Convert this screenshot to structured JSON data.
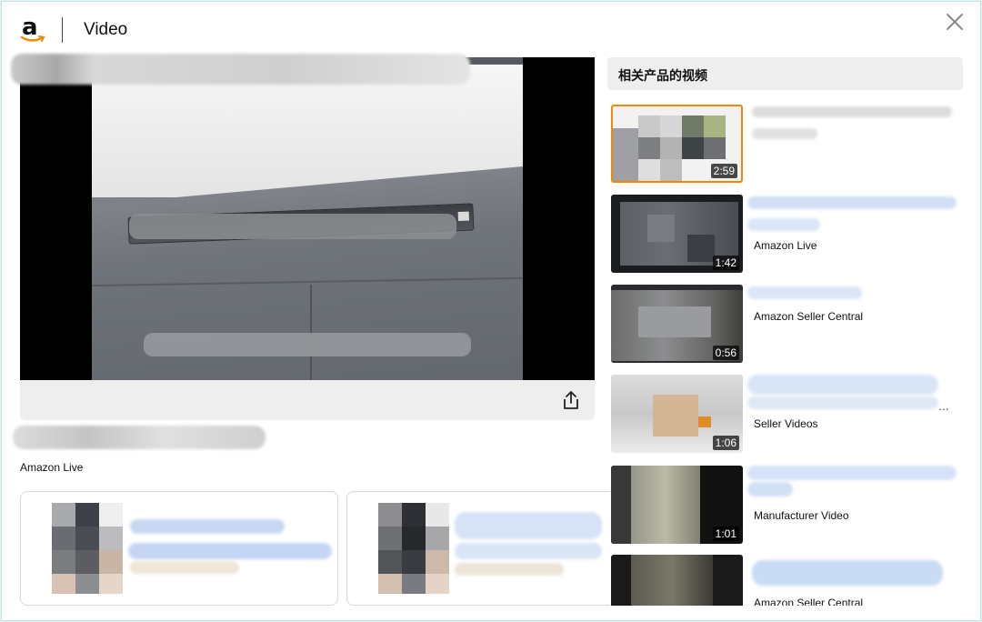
{
  "header": {
    "logo_letter": "a",
    "title": "Video"
  },
  "player": {
    "channel": "Amazon Live"
  },
  "related": {
    "heading": "相关产品的视频",
    "items": [
      {
        "duration": "2:59",
        "source": ""
      },
      {
        "duration": "1:42",
        "source": "Amazon Live"
      },
      {
        "duration": "0:56",
        "source": "Amazon Seller Central"
      },
      {
        "duration": "1:06",
        "source": "Seller Videos"
      },
      {
        "duration": "1:01",
        "source": "Manufacturer Video"
      },
      {
        "duration": "",
        "source": "Amazon Seller Central"
      }
    ],
    "overflow_marker": "..."
  },
  "colors": {
    "accent_border": "#f08804",
    "link_blur": "#b8cff0"
  },
  "icons": {
    "close": "close-icon",
    "share": "share-icon"
  }
}
